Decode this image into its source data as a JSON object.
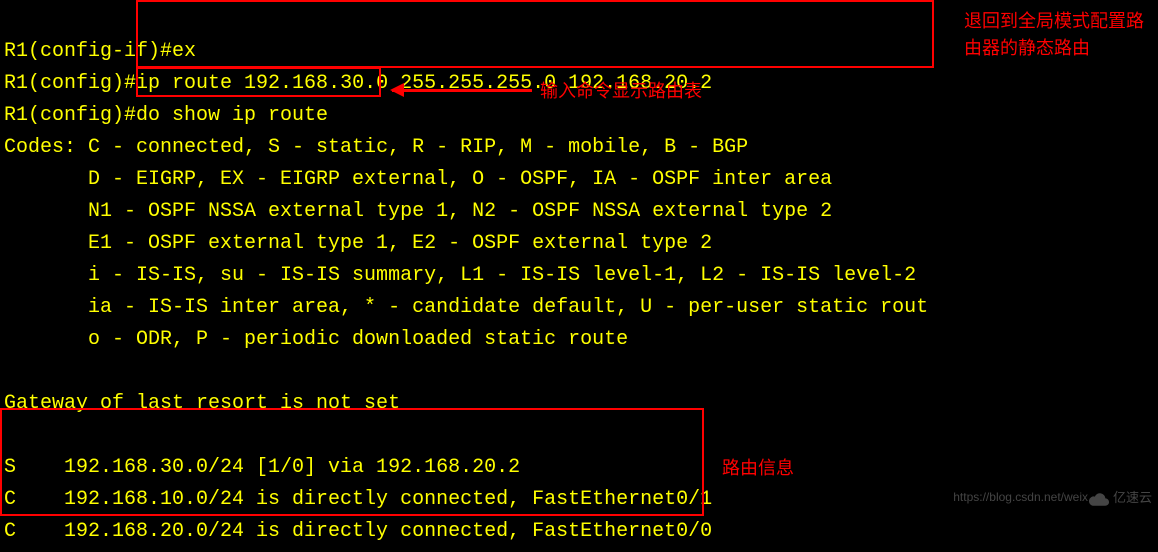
{
  "terminal": {
    "line1_prompt": "R1(config-if)#",
    "line1_cmd": "ex",
    "line2_prompt": "R1(config)#",
    "line2_cmd": "ip route 192.168.30.0 255.255.255.0 192.168.20.2",
    "line3_prompt": "R1(config)#",
    "line3_cmd": "do show ip route",
    "codes_label": "Codes: ",
    "codes_l1": "C - connected, S - static, R - RIP, M - mobile, B - BGP",
    "codes_l2": "       D - EIGRP, EX - EIGRP external, O - OSPF, IA - OSPF inter area",
    "codes_l3": "       N1 - OSPF NSSA external type 1, N2 - OSPF NSSA external type 2",
    "codes_l4": "       E1 - OSPF external type 1, E2 - OSPF external type 2",
    "codes_l5": "       i - IS-IS, su - IS-IS summary, L1 - IS-IS level-1, L2 - IS-IS level-2",
    "codes_l6": "       ia - IS-IS inter area, * - candidate default, U - per-user static rout",
    "codes_l7": "       o - ODR, P - periodic downloaded static route",
    "blank": "",
    "gateway": "Gateway of last resort is not set",
    "route1": "S    192.168.30.0/24 [1/0] via 192.168.20.2",
    "route2": "C    192.168.10.0/24 is directly connected, FastEthernet0/1",
    "route3": "C    192.168.20.0/24 is directly connected, FastEthernet0/0"
  },
  "annotations": {
    "top_right": "退回到全局模式配置路由器的静态路由",
    "mid": "输入命令显示路由表",
    "bottom": "路由信息"
  },
  "watermark": "https://blog.csdn.net/weix",
  "logo": "亿速云"
}
